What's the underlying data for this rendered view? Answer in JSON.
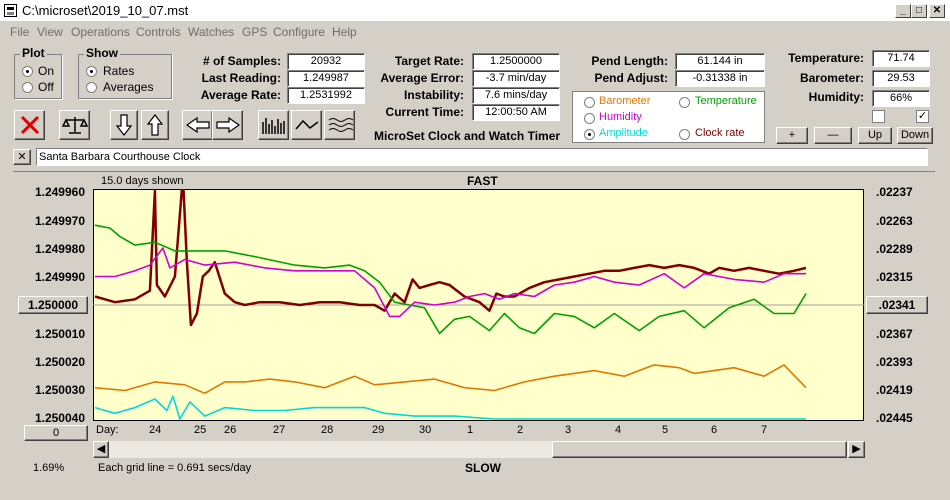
{
  "window": {
    "title": "C:\\microset\\2019_10_07.mst"
  },
  "menu": [
    "File",
    "View",
    "Operations",
    "Controls",
    "Watches",
    "GPS",
    "Configure",
    "Help"
  ],
  "plot_group": {
    "title": "Plot",
    "on": "On",
    "off": "Off",
    "selected": "On"
  },
  "show_group": {
    "title": "Show",
    "rates": "Rates",
    "averages": "Averages",
    "selected": "Rates"
  },
  "stats": {
    "samples_label": "# of Samples:",
    "samples": "20932",
    "last_label": "Last Reading:",
    "last": "1.249987",
    "avg_label": "Average Rate:",
    "avg": "1.2531992",
    "target_label": "Target Rate:",
    "target": "1.2500000",
    "avg_err_label": "Average Error:",
    "avg_err": "-3.7 min/day",
    "instab_label": "Instability:",
    "instab": "7.6 mins/day",
    "time_label": "Current Time:",
    "time": "12:00:50 AM",
    "pend_len_label": "Pend Length:",
    "pend_len": "61.144 in",
    "pend_adj_label": "Pend Adjust:",
    "pend_adj": "-0.31338 in",
    "temp_label": "Temperature:",
    "temp": "71.74",
    "baro_label": "Barometer:",
    "baro": "29.53",
    "hum_label": "Humidity:",
    "hum": "66%"
  },
  "app_caption": "MicroSet Clock and Watch Timer",
  "series_options": {
    "barometer": "Barometer",
    "temperature": "Temperature",
    "humidity": "Humidity",
    "amplitude": "Amplitude",
    "clock_rate": "Clock rate",
    "selected": "Amplitude",
    "colors": {
      "barometer": "#e07800",
      "temperature": "#00a000",
      "humidity": "#d000d0",
      "amplitude": "#00d8d8",
      "clock_rate": "#800000"
    }
  },
  "adjust_buttons": {
    "plus": "+",
    "minus": "—",
    "up": "Up",
    "down": "Down"
  },
  "clock_name": "Santa Barbara Courthouse Clock",
  "close_x": "✕",
  "chart_data": {
    "type": "line",
    "title": "FAST",
    "bottom_label": "SLOW",
    "days_shown": "15.0 days shown",
    "grid_note": "Each grid line = 0.691 secs/day",
    "x_label": "Day:",
    "x_ticks": [
      "24",
      "25",
      "26",
      "27",
      "28",
      "29",
      "30",
      "1",
      "2",
      "3",
      "4",
      "5",
      "6",
      "7"
    ],
    "y_left_ticks": [
      "1.249960",
      "1.249970",
      "1.249980",
      "1.249990",
      "1.250000",
      "1.250010",
      "1.250020",
      "1.250030",
      "1.250040"
    ],
    "y_left_center": "1.250000",
    "y_right_ticks": [
      ".02237",
      ".02263",
      ".02289",
      ".02315",
      ".02341",
      ".02367",
      ".02393",
      ".02419",
      ".02445"
    ],
    "y_right_center": ".02341",
    "ylim": [
      1.24996,
      1.25004
    ],
    "bottom_left_value": "0",
    "zoom_pct": "1.69%",
    "series": [
      {
        "name": "Clock rate",
        "color": "#800000",
        "values": [
          [
            0,
            1.249997
          ],
          [
            10,
            1.249998
          ],
          [
            20,
            1.249999
          ],
          [
            40,
            1.249998
          ],
          [
            55,
            1.249995
          ],
          [
            60,
            1.24996
          ],
          [
            62,
            1.249993
          ],
          [
            70,
            1.249997
          ],
          [
            80,
            1.24999
          ],
          [
            88,
            1.249955
          ],
          [
            92,
            1.249985
          ],
          [
            96,
            1.250007
          ],
          [
            102,
            1.250003
          ],
          [
            108,
            1.24999
          ],
          [
            114,
            1.249988
          ],
          [
            120,
            1.249985
          ],
          [
            130,
            1.249996
          ],
          [
            140,
            1.249999
          ],
          [
            150,
            1.25
          ],
          [
            165,
            1.249999
          ],
          [
            185,
            1.249999
          ],
          [
            205,
            1.25
          ],
          [
            225,
            1.249999
          ],
          [
            245,
            1.249999
          ],
          [
            265,
            1.25
          ],
          [
            280,
            1.25
          ],
          [
            290,
            1.250002
          ],
          [
            300,
            1.249996
          ],
          [
            310,
            1.249999
          ],
          [
            318,
            1.249991
          ],
          [
            325,
            1.249994
          ],
          [
            335,
            1.249993
          ],
          [
            345,
            1.249992
          ],
          [
            355,
            1.249993
          ],
          [
            370,
            1.249997
          ],
          [
            385,
            1.249999
          ],
          [
            395,
            1.250002
          ],
          [
            402,
            1.249996
          ],
          [
            410,
            1.249997
          ],
          [
            420,
            1.249997
          ],
          [
            435,
            1.249994
          ],
          [
            450,
            1.249992
          ],
          [
            465,
            1.249991
          ],
          [
            480,
            1.24999
          ],
          [
            495,
            1.249989
          ],
          [
            510,
            1.249988
          ],
          [
            525,
            1.249988
          ],
          [
            540,
            1.249987
          ],
          [
            555,
            1.249986
          ],
          [
            570,
            1.249987
          ],
          [
            585,
            1.249986
          ],
          [
            600,
            1.249987
          ],
          [
            615,
            1.249989
          ],
          [
            625,
            1.249987
          ],
          [
            640,
            1.249988
          ],
          [
            655,
            1.249987
          ],
          [
            670,
            1.249988
          ],
          [
            685,
            1.249989
          ],
          [
            700,
            1.249988
          ],
          [
            712,
            1.249987
          ]
        ]
      },
      {
        "name": "Temperature",
        "color": "#00a000",
        "values": [
          [
            0,
            1.249972
          ],
          [
            15,
            1.249973
          ],
          [
            25,
            1.249976
          ],
          [
            40,
            1.249979
          ],
          [
            60,
            1.249978
          ],
          [
            80,
            1.249981
          ],
          [
            100,
            1.249981
          ],
          [
            130,
            1.249981
          ],
          [
            160,
            1.249983
          ],
          [
            200,
            1.249986
          ],
          [
            230,
            1.249987
          ],
          [
            255,
            1.249986
          ],
          [
            270,
            1.249988
          ],
          [
            285,
            1.249992
          ],
          [
            300,
            1.249999
          ],
          [
            315,
            1.25
          ],
          [
            330,
            1.250001
          ],
          [
            345,
            1.25001
          ],
          [
            360,
            1.250005
          ],
          [
            375,
            1.250004
          ],
          [
            395,
            1.250009
          ],
          [
            410,
            1.250003
          ],
          [
            425,
            1.250008
          ],
          [
            440,
            1.25001
          ],
          [
            460,
            1.250003
          ],
          [
            480,
            1.250004
          ],
          [
            500,
            1.250008
          ],
          [
            520,
            1.250003
          ],
          [
            545,
            1.250009
          ],
          [
            565,
            1.250004
          ],
          [
            590,
            1.250002
          ],
          [
            610,
            1.250008
          ],
          [
            635,
            1.250001
          ],
          [
            660,
            1.249998
          ],
          [
            680,
            1.250003
          ],
          [
            700,
            1.250003
          ],
          [
            712,
            1.249996
          ]
        ]
      },
      {
        "name": "Humidity",
        "color": "#d000d0",
        "values": [
          [
            0,
            1.24999
          ],
          [
            20,
            1.24999
          ],
          [
            40,
            1.249988
          ],
          [
            55,
            1.249986
          ],
          [
            68,
            1.24998
          ],
          [
            75,
            1.249987
          ],
          [
            90,
            1.249984
          ],
          [
            110,
            1.249986
          ],
          [
            140,
            1.249985
          ],
          [
            170,
            1.249987
          ],
          [
            200,
            1.249988
          ],
          [
            230,
            1.249988
          ],
          [
            260,
            1.249988
          ],
          [
            280,
            1.249994
          ],
          [
            295,
            1.250004
          ],
          [
            305,
            1.250004
          ],
          [
            320,
            1.249999
          ],
          [
            340,
            1.25
          ],
          [
            360,
            1.249999
          ],
          [
            375,
            1.249997
          ],
          [
            390,
            1.249996
          ],
          [
            405,
            1.249998
          ],
          [
            420,
            1.249996
          ],
          [
            440,
            1.249997
          ],
          [
            460,
            1.249993
          ],
          [
            480,
            1.249992
          ],
          [
            500,
            1.24999
          ],
          [
            520,
            1.249992
          ],
          [
            545,
            1.249993
          ],
          [
            570,
            1.249989
          ],
          [
            590,
            1.249994
          ],
          [
            610,
            1.249989
          ],
          [
            640,
            1.249991
          ],
          [
            670,
            1.249992
          ],
          [
            690,
            1.249989
          ],
          [
            712,
            1.249989
          ]
        ]
      },
      {
        "name": "Barometer",
        "color": "#e07800",
        "values": [
          [
            0,
            1.250029
          ],
          [
            30,
            1.25003
          ],
          [
            60,
            1.250027
          ],
          [
            90,
            1.250028
          ],
          [
            110,
            1.250031
          ],
          [
            130,
            1.250027
          ],
          [
            150,
            1.250027
          ],
          [
            175,
            1.250026
          ],
          [
            200,
            1.250027
          ],
          [
            230,
            1.250029
          ],
          [
            260,
            1.250025
          ],
          [
            280,
            1.250028
          ],
          [
            310,
            1.250027
          ],
          [
            340,
            1.250026
          ],
          [
            370,
            1.250029
          ],
          [
            400,
            1.25003
          ],
          [
            430,
            1.250027
          ],
          [
            460,
            1.250025
          ],
          [
            480,
            1.250024
          ],
          [
            500,
            1.250023
          ],
          [
            530,
            1.250025
          ],
          [
            560,
            1.250021
          ],
          [
            585,
            1.250022
          ],
          [
            600,
            1.250024
          ],
          [
            620,
            1.250023
          ],
          [
            640,
            1.250022
          ],
          [
            670,
            1.250025
          ],
          [
            690,
            1.250021
          ],
          [
            712,
            1.250029
          ]
        ]
      },
      {
        "name": "Amplitude",
        "color": "#00d8d8",
        "values": [
          [
            0,
            1.250036
          ],
          [
            20,
            1.250038
          ],
          [
            40,
            1.250036
          ],
          [
            60,
            1.250033
          ],
          [
            72,
            1.250037
          ],
          [
            78,
            1.250032
          ],
          [
            85,
            1.25004
          ],
          [
            95,
            1.250034
          ],
          [
            110,
            1.250039
          ],
          [
            130,
            1.250036
          ],
          [
            160,
            1.250037
          ],
          [
            190,
            1.250037
          ],
          [
            220,
            1.250036
          ],
          [
            250,
            1.250036
          ],
          [
            270,
            1.250036
          ],
          [
            290,
            1.250038
          ],
          [
            320,
            1.250039
          ],
          [
            360,
            1.250039
          ],
          [
            400,
            1.25004
          ],
          [
            450,
            1.25004
          ],
          [
            712,
            1.25004
          ]
        ]
      }
    ]
  }
}
